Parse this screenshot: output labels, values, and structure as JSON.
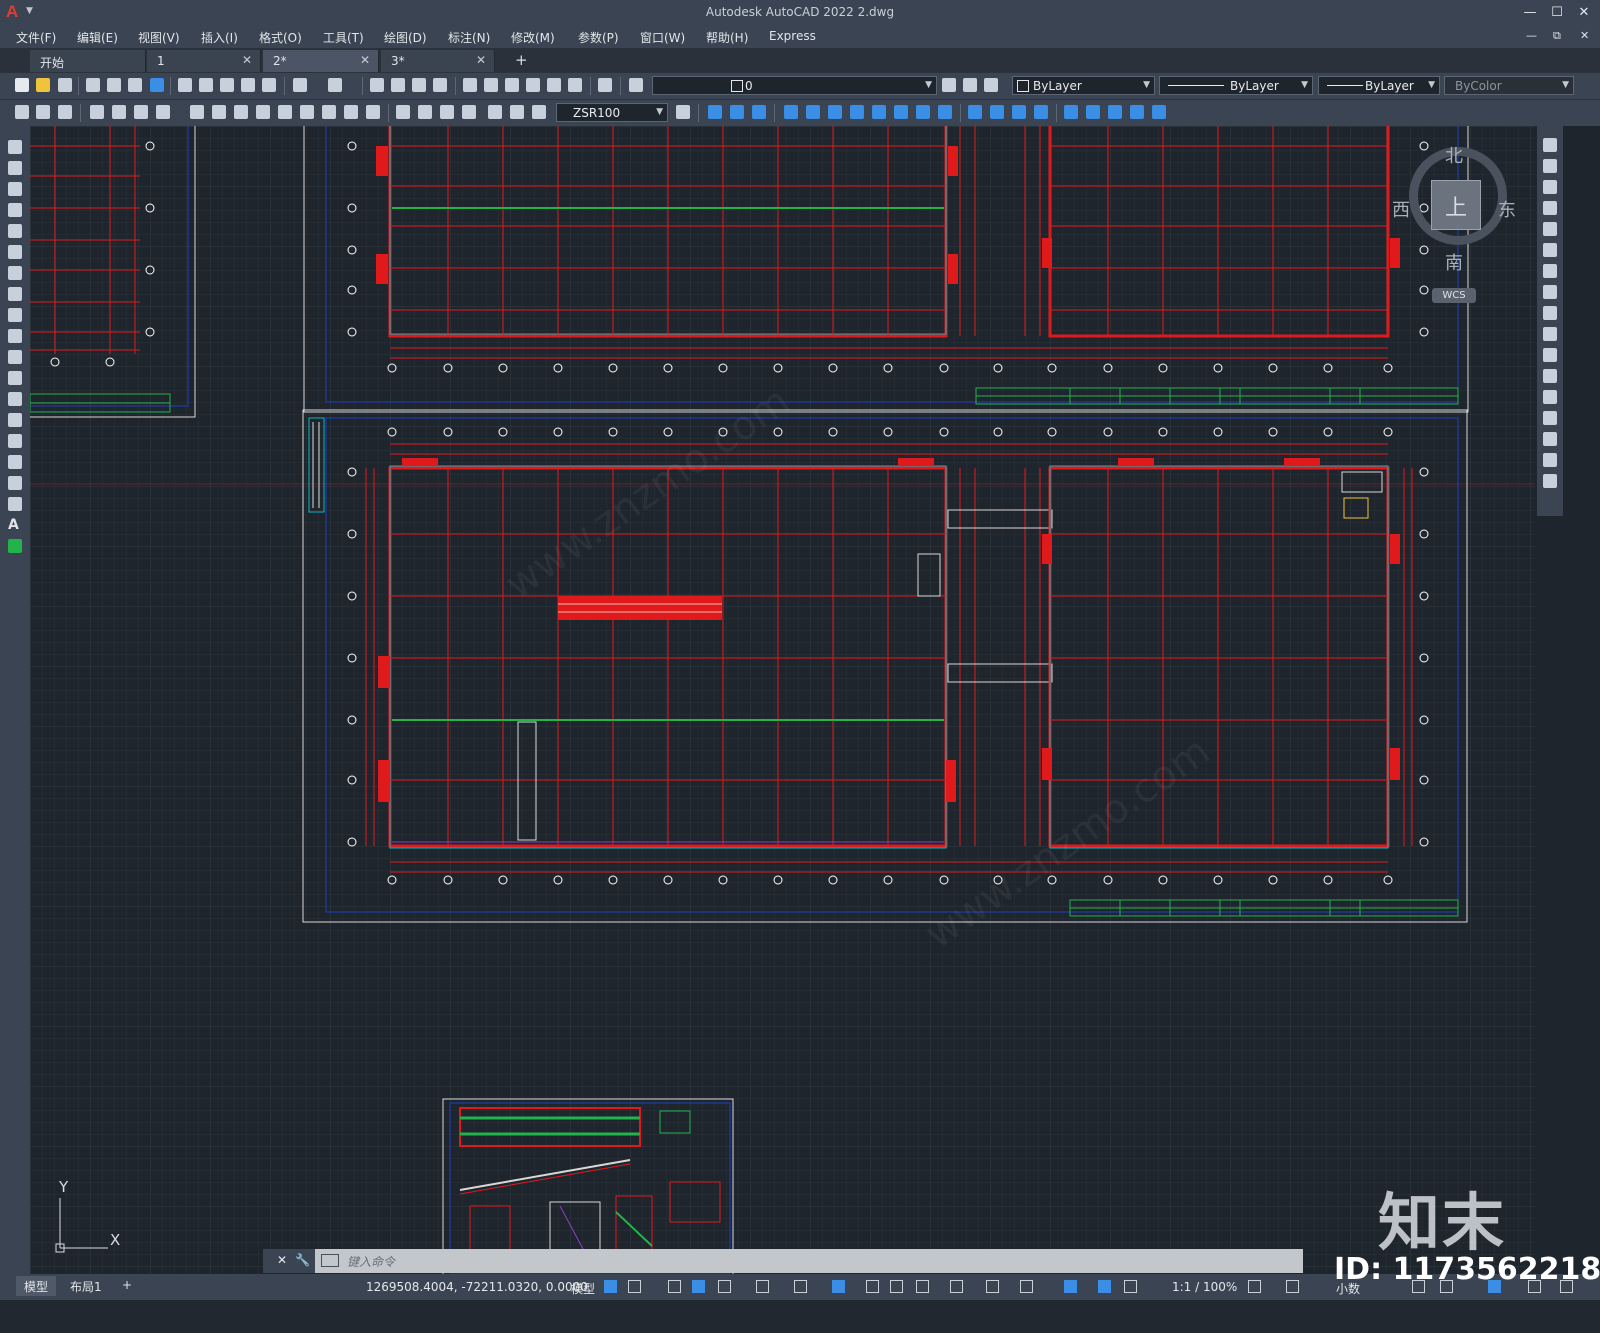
{
  "app": {
    "logo": "A",
    "title": "Autodesk AutoCAD 2022    2.dwg",
    "window_buttons": [
      "—",
      "☐",
      "✕"
    ],
    "mdi_buttons": [
      "—",
      "⧉",
      "✕"
    ]
  },
  "menu": [
    "文件(F)",
    "编辑(E)",
    "视图(V)",
    "插入(I)",
    "格式(O)",
    "工具(T)",
    "绘图(D)",
    "标注(N)",
    "修改(M)",
    "参数(P)",
    "窗口(W)",
    "帮助(H)",
    "Express"
  ],
  "tabs": [
    {
      "label": "开始",
      "closable": false,
      "active": false
    },
    {
      "label": "1",
      "closable": true,
      "active": false
    },
    {
      "label": "2*",
      "closable": true,
      "active": true
    },
    {
      "label": "3*",
      "closable": true,
      "active": false
    }
  ],
  "tab_add": "+",
  "properties": {
    "layer": "0",
    "color": "ByLayer",
    "linetype": "ByLayer",
    "lineweight": "ByLayer",
    "plotstyle": "ByColor",
    "dimstyle": "ZSR100"
  },
  "viewcube": {
    "north": "北",
    "south": "南",
    "east": "东",
    "west": "西",
    "face": "上",
    "wcs": "WCS"
  },
  "ucs": {
    "x": "X",
    "y": "Y"
  },
  "command": {
    "placeholder": "键入命令",
    "close": "✕"
  },
  "layouts": [
    "模型",
    "布局1",
    "+"
  ],
  "status": {
    "coords": "1269508.4004, -72211.0320, 0.0000",
    "space": "模型",
    "scale": "1:1 / 100%",
    "units": "小数"
  },
  "watermark": {
    "logo": "知末",
    "id": "ID: 1173562218",
    "url": "www.znzmo.com"
  },
  "colors": {
    "background": "#1f252d",
    "chrome": "#3b4452",
    "grid_red": "#e01a1a",
    "dim_green": "#22b34a",
    "frame_blue": "#1d3fbf",
    "accent": "#3a8ee6"
  }
}
